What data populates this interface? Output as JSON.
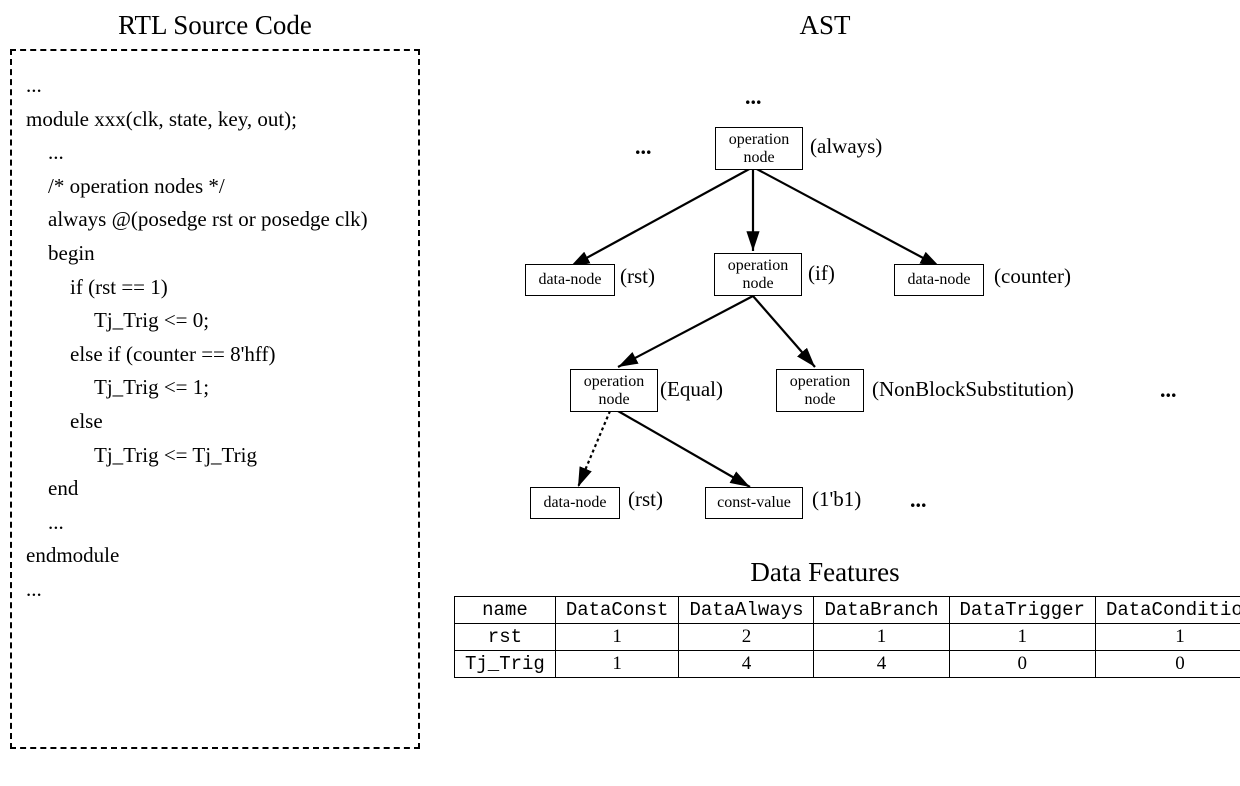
{
  "left": {
    "title": "RTL Source Code",
    "lines": [
      {
        "t": "...",
        "i": 0
      },
      {
        "t": "module xxx(clk, state, key, out);",
        "i": 0
      },
      {
        "t": "...",
        "i": 1
      },
      {
        "t": "/* operation nodes */",
        "i": 1
      },
      {
        "t": "always @(posedge rst or posedge clk)",
        "i": 1
      },
      {
        "t": "begin",
        "i": 1
      },
      {
        "t": "if (rst == 1)",
        "i": 2
      },
      {
        "t": "Tj_Trig <= 0;",
        "i": 3
      },
      {
        "t": "else if (counter == 8'hff)",
        "i": 2
      },
      {
        "t": "Tj_Trig <= 1;",
        "i": 3
      },
      {
        "t": "else",
        "i": 2
      },
      {
        "t": "Tj_Trig <= Tj_Trig",
        "i": 3
      },
      {
        "t": "end",
        "i": 1
      },
      {
        "t": "...",
        "i": 1
      },
      {
        "t": "endmodule",
        "i": 0
      },
      {
        "t": "...",
        "i": 0
      }
    ]
  },
  "ast": {
    "title": "AST",
    "dots_top": "...",
    "dots_left": "...",
    "dots_r3": "...",
    "dots_r4": "...",
    "nodes": {
      "always": {
        "text": "operation\nnode",
        "label": "(always)"
      },
      "rst1": {
        "text": "data-node",
        "label": "(rst)"
      },
      "if": {
        "text": "operation\nnode",
        "label": "(if)"
      },
      "counter": {
        "text": "data-node",
        "label": "(counter)"
      },
      "equal": {
        "text": "operation\nnode",
        "label": "(Equal)"
      },
      "nbs": {
        "text": "operation\nnode",
        "label": "(NonBlockSubstitution)"
      },
      "rst2": {
        "text": "data-node",
        "label": "(rst)"
      },
      "const": {
        "text": "const-value",
        "label": "(1'b1)"
      }
    }
  },
  "df": {
    "title": "Data Features",
    "headers": [
      "name",
      "DataConst",
      "DataAlways",
      "DataBranch",
      "DataTrigger",
      "DataCondition"
    ],
    "rows": [
      {
        "name": "rst",
        "vals": [
          1,
          2,
          1,
          1,
          1
        ]
      },
      {
        "name": "Tj_Trig",
        "vals": [
          1,
          4,
          4,
          0,
          0
        ]
      }
    ]
  }
}
